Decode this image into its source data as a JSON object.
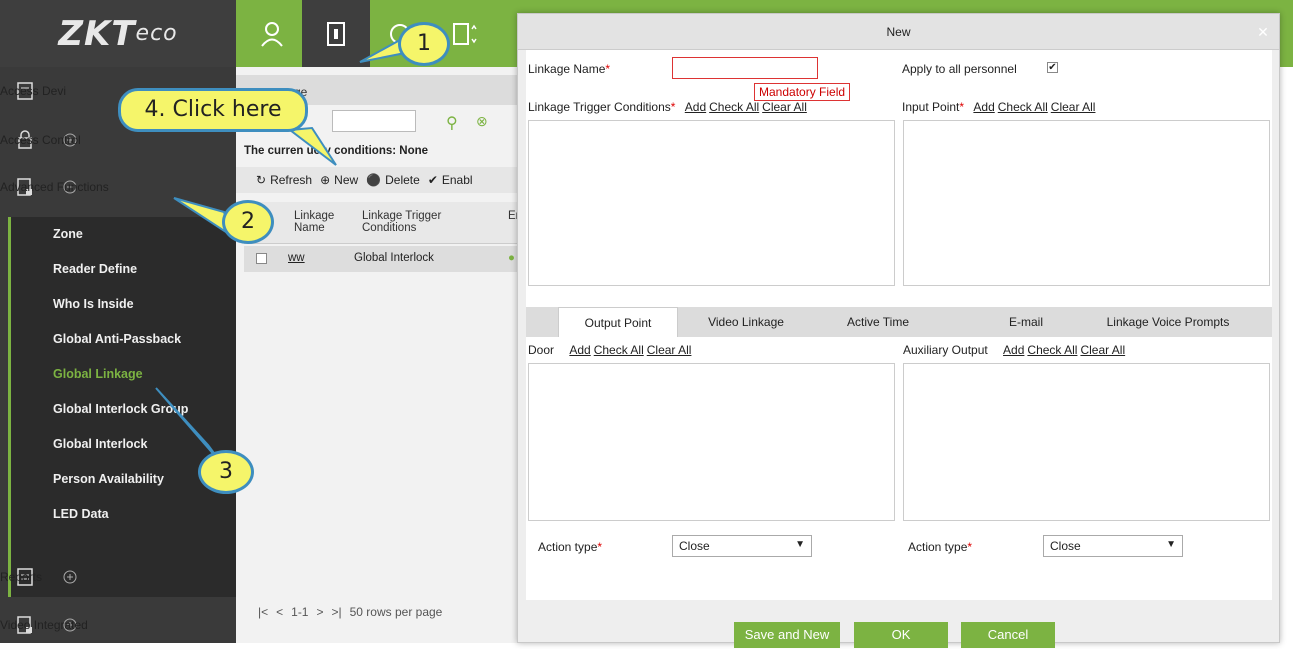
{
  "app": {
    "logo_main": "ZKT",
    "logo_sub": "eco"
  },
  "sidebar": {
    "items": [
      {
        "label": "Access Devi",
        "icon": "device-icon"
      },
      {
        "label": "Access Control",
        "icon": "lock-icon"
      },
      {
        "label": "Advanced Functions",
        "icon": "advanced-icon"
      },
      {
        "label": "Reports",
        "icon": "reports-icon"
      },
      {
        "label": "Video Integrated",
        "icon": "video-icon"
      }
    ],
    "subitems": [
      "Zone",
      "Reader Define",
      "Who Is Inside",
      "Global Anti-Passback",
      "Global Linkage",
      "Global Interlock Group",
      "Global Interlock",
      "Person Availability",
      "LED Data"
    ],
    "active_subitem": "Global Linkage"
  },
  "main": {
    "panel_title": "ge",
    "query_conditions": "The curren  uery conditions: None",
    "toolbar": {
      "refresh": "Refresh",
      "new": "New",
      "delete": "Delete",
      "enable": "Enabl"
    },
    "table": {
      "headers": [
        "Linkage Name",
        "Linkage Trigger Conditions",
        "En"
      ],
      "rows": [
        {
          "name": "ww",
          "trigger": "Global Interlock"
        }
      ]
    },
    "pager": {
      "range": "1-1",
      "rows_per_page": "50 rows per page"
    }
  },
  "modal": {
    "title": "New",
    "linkage_name_label": "Linkage Name",
    "mandatory_tip": "Mandatory Field",
    "apply_all_label": "Apply to all personnel",
    "trigger_label": "Linkage Trigger Conditions",
    "input_point_label": "Input Point",
    "link_add": "Add",
    "link_check_all": "Check All",
    "link_clear_all": "Clear All",
    "tabs": [
      "Output Point",
      "Video Linkage",
      "Active Time",
      "E-mail",
      "Linkage Voice Prompts"
    ],
    "door_label": "Door",
    "aux_output_label": "Auxiliary Output",
    "action_type_label": "Action type",
    "action_type_value_left": "Close",
    "action_type_value_right": "Close",
    "buttons": {
      "save_new": "Save and New",
      "ok": "OK",
      "cancel": "Cancel"
    }
  },
  "callouts": {
    "c1": "1",
    "c2": "2",
    "c3": "3",
    "c4": "4. Click here"
  },
  "colors": {
    "brand_green": "#7cb342",
    "sidebar_dark": "#3a3a3a",
    "callout_yellow": "#f5f56a",
    "callout_border": "#3e8ebf"
  }
}
